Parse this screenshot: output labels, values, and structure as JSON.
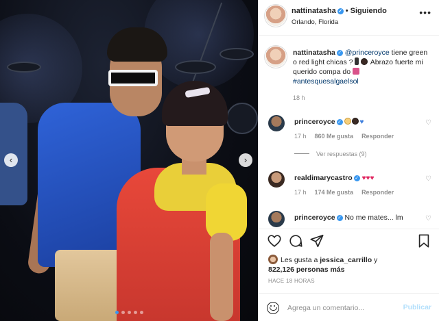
{
  "post": {
    "slide_count": 5,
    "active_slide": 1
  },
  "header": {
    "username": "nattinatasha",
    "separator": "•",
    "follow_label": "Siguiendo",
    "location": "Orlando, Florida",
    "more_icon": "more-horizontal-icon"
  },
  "caption": {
    "username": "nattinatasha",
    "mention": "@princeroyce",
    "text_1": " tiene green o red light chicas ? ",
    "text_2": " Abrazo fuerte mi querido compa do ",
    "hashtag": "#antesquesalgaelsol",
    "time": "18 h"
  },
  "comments": [
    {
      "username": "princeroyce",
      "time": "17 h",
      "likes": "860 Me gusta",
      "reply": "Responder",
      "view_replies": "Ver respuestas (9)"
    },
    {
      "username": "realdimarycastro",
      "time": "17 h",
      "likes": "174 Me gusta",
      "reply": "Responder"
    },
    {
      "username": "princeroyce",
      "text": "No me mates... lm"
    }
  ],
  "likes": {
    "prefix": "Les gusta a ",
    "user": "jessica_carrillo",
    "middle": " y",
    "count": "822,126 personas más"
  },
  "posted_time": "HACE 18 HORAS",
  "add_comment": {
    "placeholder": "Agrega un comentario...",
    "post_label": "Publicar"
  },
  "colors": {
    "accent": "#3897f0",
    "link": "#00376b",
    "muted": "#8e8e8e",
    "post_disabled": "#b2dffc"
  }
}
